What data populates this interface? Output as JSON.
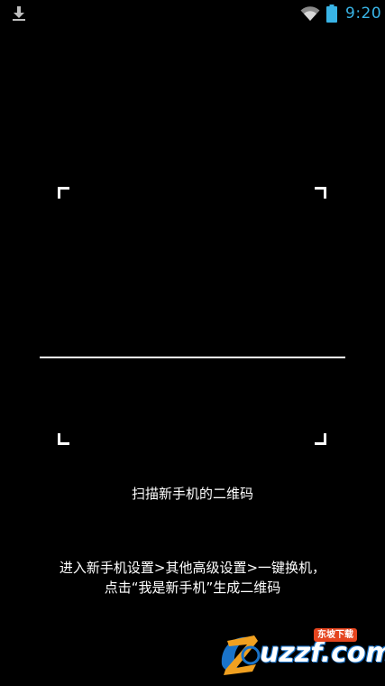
{
  "status_bar": {
    "time": "9:20",
    "icons": [
      "download-icon",
      "wifi-icon",
      "battery-icon"
    ],
    "accent_color": "#39b4e6"
  },
  "scanner": {
    "title": "扫描新手机的二维码",
    "instruction_line1": "进入新手机设置>其他高级设置>一键换机，",
    "instruction_line2": "点击“我是新手机”生成二维码"
  },
  "watermark": {
    "text": "uzzf.com",
    "badge": "东坡下载"
  }
}
